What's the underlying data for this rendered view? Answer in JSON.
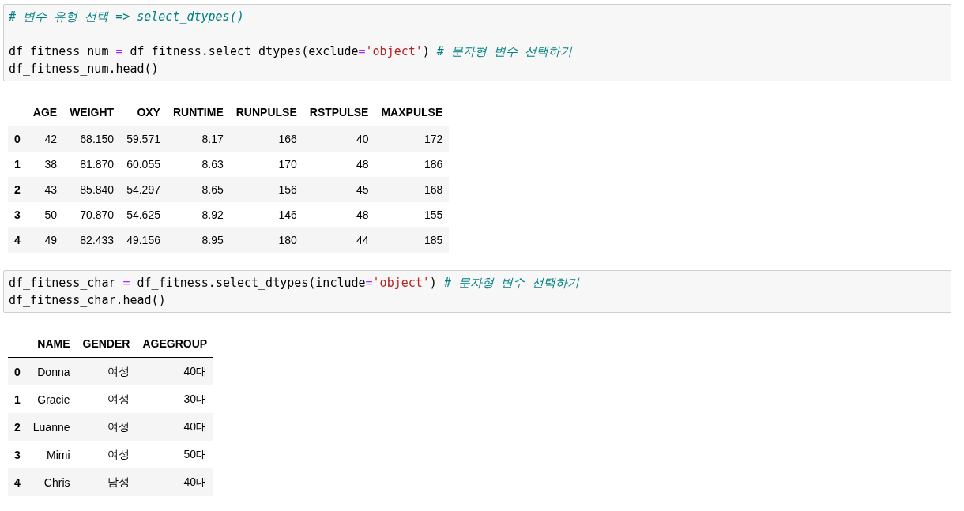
{
  "cells": [
    {
      "code": [
        {
          "kind": "code",
          "tokens": [
            {
              "kind": "comment",
              "text": "# 변수 유형 선택 => select_dtypes()"
            }
          ]
        },
        {
          "kind": "blank"
        },
        {
          "kind": "code",
          "tokens": [
            {
              "kind": "plain",
              "text": "df_fitness_num "
            },
            {
              "kind": "operator",
              "text": "="
            },
            {
              "kind": "plain",
              "text": " df_fitness.select_dtypes(exclude"
            },
            {
              "kind": "operator",
              "text": "="
            },
            {
              "kind": "string",
              "text": "'object'"
            },
            {
              "kind": "plain",
              "text": ") "
            },
            {
              "kind": "comment",
              "text": "# 문자형 변수 선택하기"
            }
          ]
        },
        {
          "kind": "code",
          "tokens": [
            {
              "kind": "plain",
              "text": "df_fitness_num.head()"
            }
          ]
        }
      ],
      "table": {
        "columns": [
          "AGE",
          "WEIGHT",
          "OXY",
          "RUNTIME",
          "RUNPULSE",
          "RSTPULSE",
          "MAXPULSE"
        ],
        "rows": [
          {
            "index": "0",
            "cells": [
              "42",
              "68.150",
              "59.571",
              "8.17",
              "166",
              "40",
              "172"
            ]
          },
          {
            "index": "1",
            "cells": [
              "38",
              "81.870",
              "60.055",
              "8.63",
              "170",
              "48",
              "186"
            ]
          },
          {
            "index": "2",
            "cells": [
              "43",
              "85.840",
              "54.297",
              "8.65",
              "156",
              "45",
              "168"
            ]
          },
          {
            "index": "3",
            "cells": [
              "50",
              "70.870",
              "54.625",
              "8.92",
              "146",
              "48",
              "155"
            ]
          },
          {
            "index": "4",
            "cells": [
              "49",
              "82.433",
              "49.156",
              "8.95",
              "180",
              "44",
              "185"
            ]
          }
        ]
      }
    },
    {
      "code": [
        {
          "kind": "code",
          "tokens": [
            {
              "kind": "plain",
              "text": "df_fitness_char "
            },
            {
              "kind": "operator",
              "text": "="
            },
            {
              "kind": "plain",
              "text": " df_fitness.select_dtypes(include"
            },
            {
              "kind": "operator",
              "text": "="
            },
            {
              "kind": "string",
              "text": "'object'"
            },
            {
              "kind": "plain",
              "text": ") "
            },
            {
              "kind": "comment",
              "text": "# 문자형 변수 선택하기"
            }
          ]
        },
        {
          "kind": "code",
          "tokens": [
            {
              "kind": "plain",
              "text": "df_fitness_char.head()"
            }
          ]
        }
      ],
      "table": {
        "columns": [
          "NAME",
          "GENDER",
          "AGEGROUP"
        ],
        "rows": [
          {
            "index": "0",
            "cells": [
              "Donna",
              "여성",
              "40대"
            ]
          },
          {
            "index": "1",
            "cells": [
              "Gracie",
              "여성",
              "30대"
            ]
          },
          {
            "index": "2",
            "cells": [
              "Luanne",
              "여성",
              "40대"
            ]
          },
          {
            "index": "3",
            "cells": [
              "Mimi",
              "여성",
              "50대"
            ]
          },
          {
            "index": "4",
            "cells": [
              "Chris",
              "남성",
              "40대"
            ]
          }
        ]
      }
    }
  ]
}
